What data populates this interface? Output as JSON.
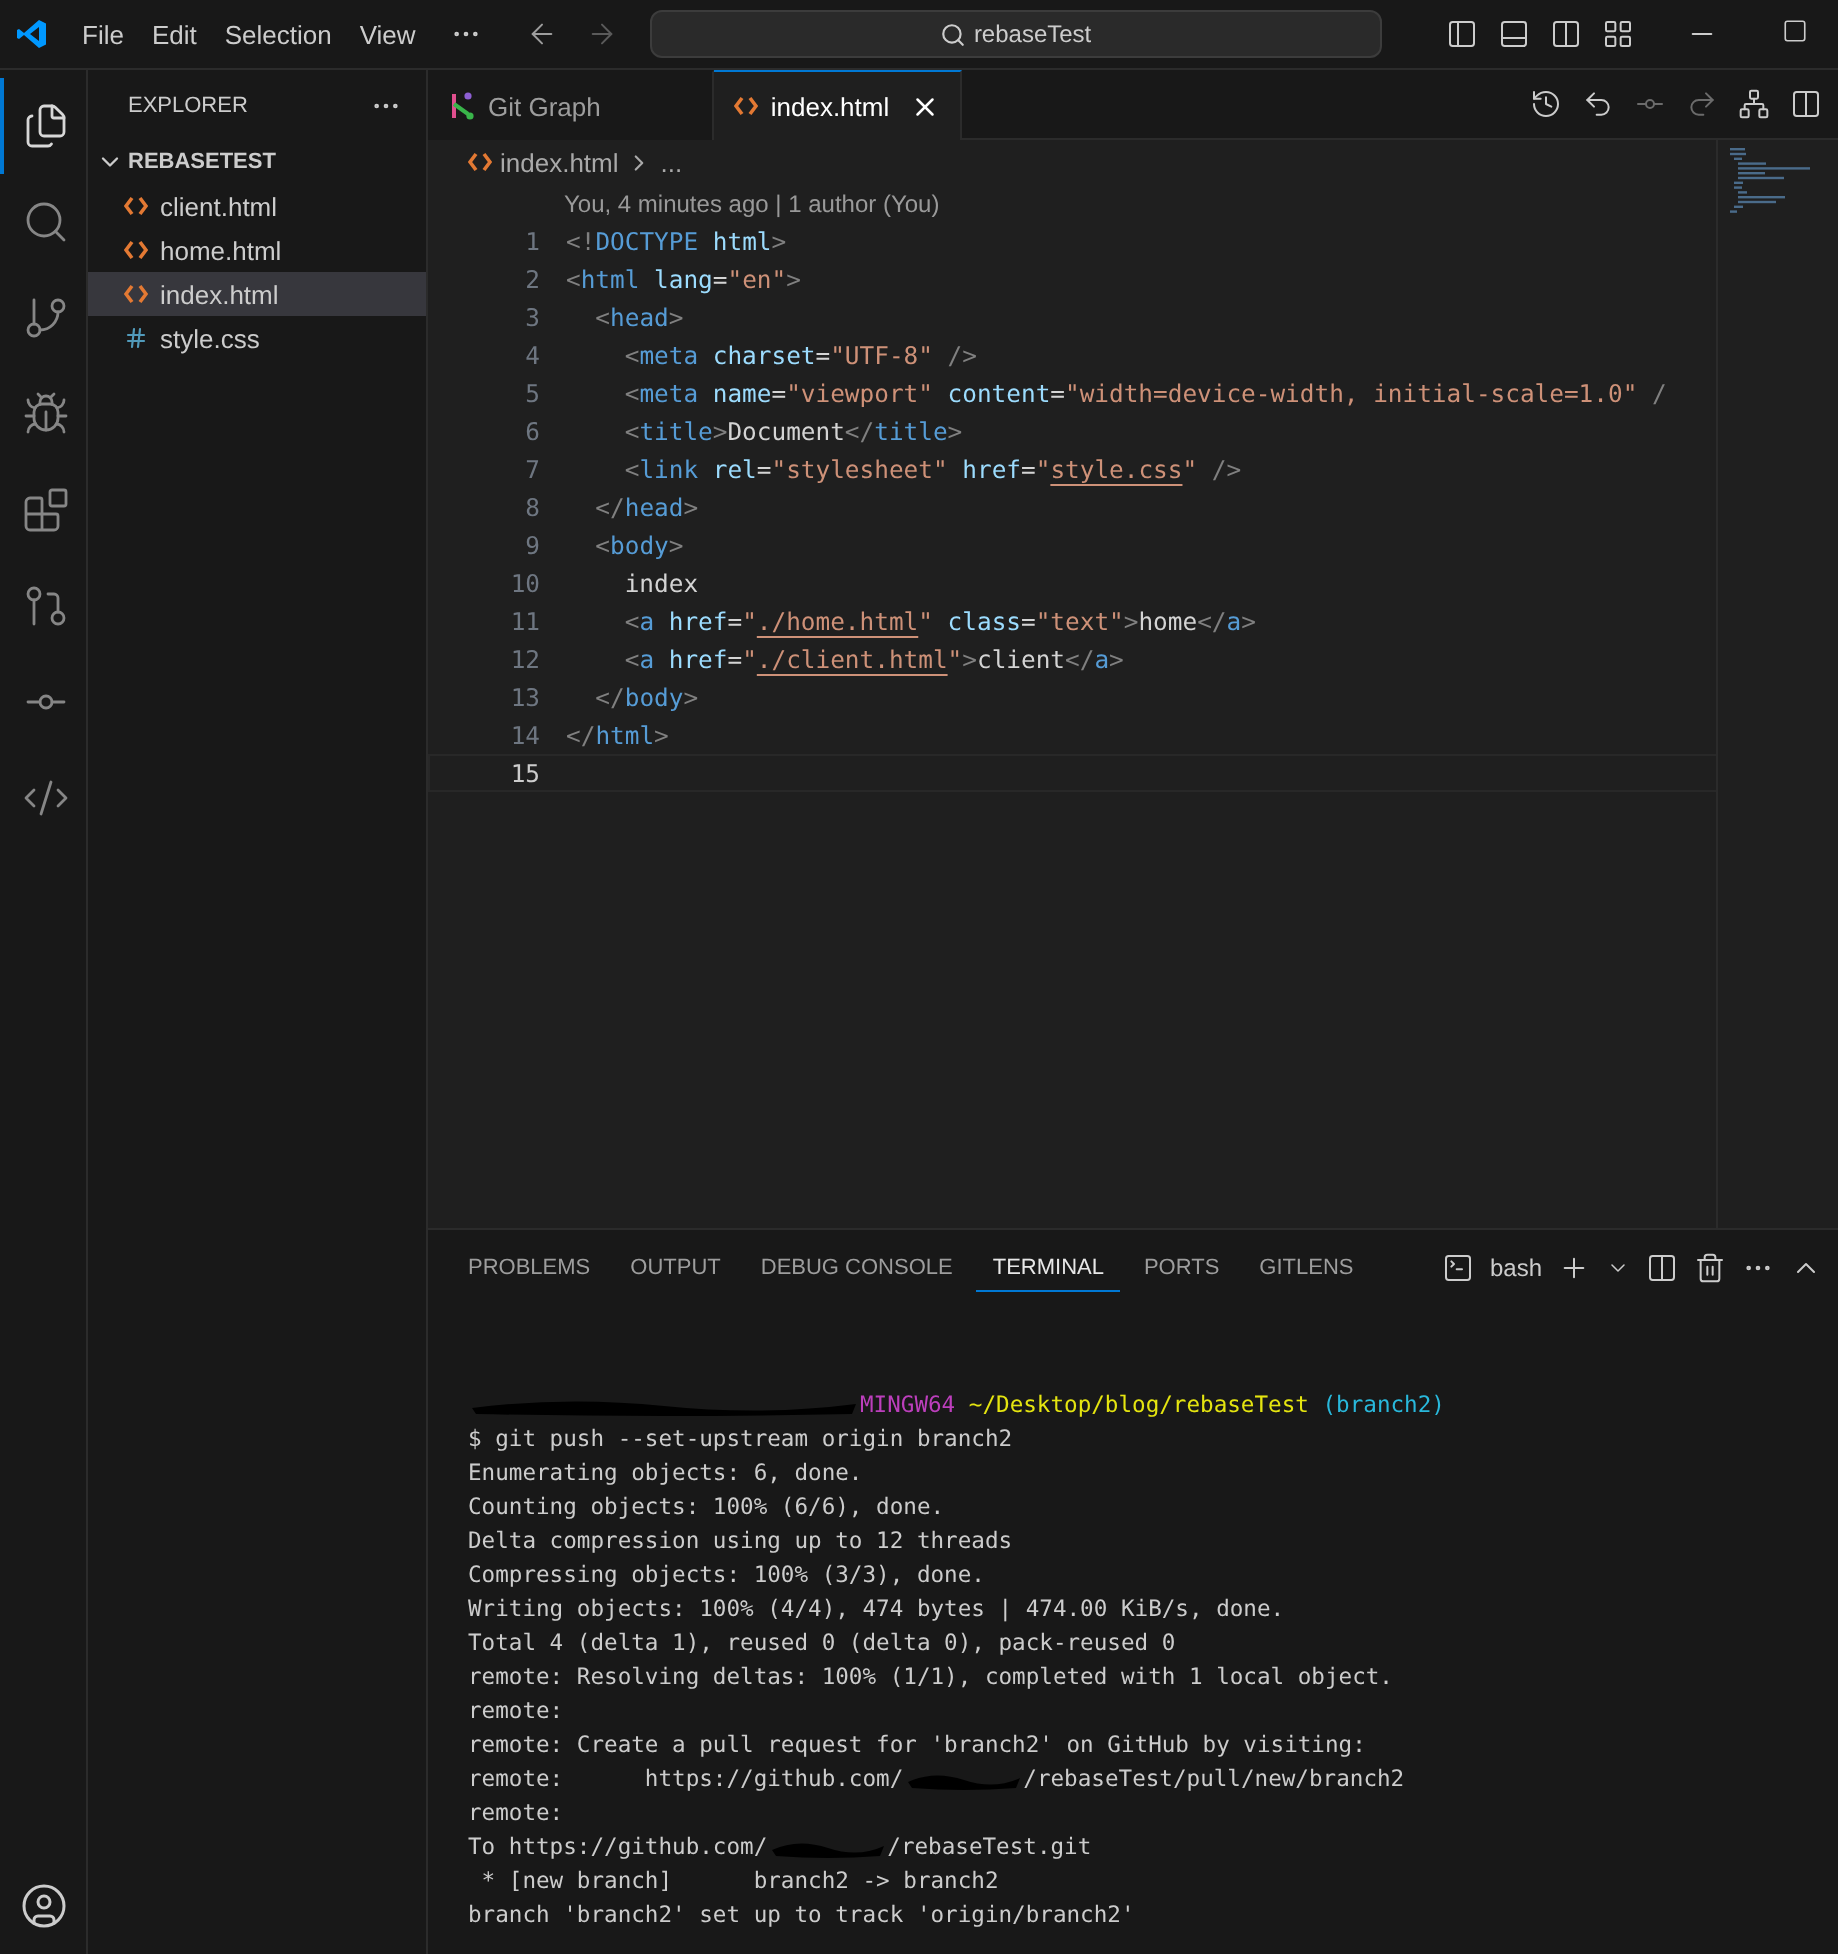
{
  "menu": [
    "File",
    "Edit",
    "Selection",
    "View"
  ],
  "command_center": {
    "text": "rebaseTest"
  },
  "activity_bar": [
    {
      "kind": "explorer",
      "selected": true
    },
    {
      "kind": "search",
      "selected": false
    },
    {
      "kind": "source-control",
      "selected": false
    },
    {
      "kind": "run-debug",
      "selected": false
    },
    {
      "kind": "extensions",
      "selected": false
    },
    {
      "kind": "git-graph",
      "selected": false
    },
    {
      "kind": "git-lens",
      "selected": false
    },
    {
      "kind": "python",
      "selected": false
    }
  ],
  "sidebar": {
    "title": "EXPLORER",
    "folder": {
      "name": "REBASETEST",
      "expanded": true,
      "files": [
        {
          "name": "client.html",
          "kind": "html",
          "selected": false
        },
        {
          "name": "home.html",
          "kind": "html",
          "selected": false
        },
        {
          "name": "index.html",
          "kind": "html",
          "selected": true
        },
        {
          "name": "style.css",
          "kind": "css",
          "selected": false
        }
      ]
    }
  },
  "tabs": [
    {
      "label": "Git Graph",
      "kind": "graph",
      "selected": false
    },
    {
      "label": "index.html",
      "kind": "html",
      "selected": true
    }
  ],
  "breadcrumb": {
    "file": "index.html",
    "rest": "..."
  },
  "blame": "You, 4 minutes ago | 1 author (You)",
  "code_lines": [
    {
      "number": "1",
      "current": false,
      "tokens": [
        {
          "kind": "punct",
          "text": "<!"
        },
        {
          "kind": "tag",
          "text": "DOCTYPE"
        },
        {
          "kind": "attr",
          "text": " html"
        },
        {
          "kind": "punct",
          "text": ">"
        }
      ]
    },
    {
      "number": "2",
      "current": false,
      "tokens": [
        {
          "kind": "punct",
          "text": "<"
        },
        {
          "kind": "tag",
          "text": "html"
        },
        {
          "kind": "attr",
          "text": " lang"
        },
        {
          "kind": "text",
          "text": "="
        },
        {
          "kind": "str",
          "text": "\"en\""
        },
        {
          "kind": "punct",
          "text": ">"
        }
      ]
    },
    {
      "number": "3",
      "current": false,
      "tokens": [
        {
          "kind": "punct",
          "text": "  <"
        },
        {
          "kind": "tag",
          "text": "head"
        },
        {
          "kind": "punct",
          "text": ">"
        }
      ]
    },
    {
      "number": "4",
      "current": false,
      "tokens": [
        {
          "kind": "punct",
          "text": "    <"
        },
        {
          "kind": "tag",
          "text": "meta"
        },
        {
          "kind": "attr",
          "text": " charset"
        },
        {
          "kind": "text",
          "text": "="
        },
        {
          "kind": "str",
          "text": "\"UTF-8\""
        },
        {
          "kind": "punct",
          "text": " />"
        }
      ]
    },
    {
      "number": "5",
      "current": false,
      "tokens": [
        {
          "kind": "punct",
          "text": "    <"
        },
        {
          "kind": "tag",
          "text": "meta"
        },
        {
          "kind": "attr",
          "text": " name"
        },
        {
          "kind": "text",
          "text": "="
        },
        {
          "kind": "str",
          "text": "\"viewport\""
        },
        {
          "kind": "attr",
          "text": " content"
        },
        {
          "kind": "text",
          "text": "="
        },
        {
          "kind": "str",
          "text": "\"width=device-width, initial-scale=1.0\""
        },
        {
          "kind": "punct",
          "text": " /"
        }
      ]
    },
    {
      "number": "6",
      "current": false,
      "tokens": [
        {
          "kind": "punct",
          "text": "    <"
        },
        {
          "kind": "tag",
          "text": "title"
        },
        {
          "kind": "punct",
          "text": ">"
        },
        {
          "kind": "text",
          "text": "Document"
        },
        {
          "kind": "punct",
          "text": "</"
        },
        {
          "kind": "tag",
          "text": "title"
        },
        {
          "kind": "punct",
          "text": ">"
        }
      ]
    },
    {
      "number": "7",
      "current": false,
      "tokens": [
        {
          "kind": "punct",
          "text": "    <"
        },
        {
          "kind": "tag",
          "text": "link"
        },
        {
          "kind": "attr",
          "text": " rel"
        },
        {
          "kind": "text",
          "text": "="
        },
        {
          "kind": "str",
          "text": "\"stylesheet\""
        },
        {
          "kind": "attr",
          "text": " href"
        },
        {
          "kind": "text",
          "text": "="
        },
        {
          "kind": "str",
          "text": "\""
        },
        {
          "kind": "link",
          "text": "style.css"
        },
        {
          "kind": "str",
          "text": "\""
        },
        {
          "kind": "punct",
          "text": " />"
        }
      ]
    },
    {
      "number": "8",
      "current": false,
      "tokens": [
        {
          "kind": "punct",
          "text": "  </"
        },
        {
          "kind": "tag",
          "text": "head"
        },
        {
          "kind": "punct",
          "text": ">"
        }
      ]
    },
    {
      "number": "9",
      "current": false,
      "tokens": [
        {
          "kind": "punct",
          "text": "  <"
        },
        {
          "kind": "tag",
          "text": "body"
        },
        {
          "kind": "punct",
          "text": ">"
        }
      ]
    },
    {
      "number": "10",
      "current": false,
      "tokens": [
        {
          "kind": "text",
          "text": "    index"
        }
      ]
    },
    {
      "number": "11",
      "current": false,
      "tokens": [
        {
          "kind": "punct",
          "text": "    <"
        },
        {
          "kind": "tag",
          "text": "a"
        },
        {
          "kind": "attr",
          "text": " href"
        },
        {
          "kind": "text",
          "text": "="
        },
        {
          "kind": "str",
          "text": "\""
        },
        {
          "kind": "link",
          "text": "./home.html"
        },
        {
          "kind": "str",
          "text": "\""
        },
        {
          "kind": "attr",
          "text": " class"
        },
        {
          "kind": "text",
          "text": "="
        },
        {
          "kind": "str",
          "text": "\"text\""
        },
        {
          "kind": "punct",
          "text": ">"
        },
        {
          "kind": "text",
          "text": "home"
        },
        {
          "kind": "punct",
          "text": "</"
        },
        {
          "kind": "tag",
          "text": "a"
        },
        {
          "kind": "punct",
          "text": ">"
        }
      ]
    },
    {
      "number": "12",
      "current": false,
      "tokens": [
        {
          "kind": "punct",
          "text": "    <"
        },
        {
          "kind": "tag",
          "text": "a"
        },
        {
          "kind": "attr",
          "text": " href"
        },
        {
          "kind": "text",
          "text": "="
        },
        {
          "kind": "str",
          "text": "\""
        },
        {
          "kind": "link",
          "text": "./client.html"
        },
        {
          "kind": "str",
          "text": "\""
        },
        {
          "kind": "punct",
          "text": ">"
        },
        {
          "kind": "text",
          "text": "client"
        },
        {
          "kind": "punct",
          "text": "</"
        },
        {
          "kind": "tag",
          "text": "a"
        },
        {
          "kind": "punct",
          "text": ">"
        }
      ]
    },
    {
      "number": "13",
      "current": false,
      "tokens": [
        {
          "kind": "punct",
          "text": "  </"
        },
        {
          "kind": "tag",
          "text": "body"
        },
        {
          "kind": "punct",
          "text": ">"
        }
      ]
    },
    {
      "number": "14",
      "current": false,
      "tokens": [
        {
          "kind": "punct",
          "text": "</"
        },
        {
          "kind": "tag",
          "text": "html"
        },
        {
          "kind": "punct",
          "text": ">"
        }
      ]
    },
    {
      "number": "15",
      "current": true
    }
  ],
  "panel_tabs": [
    {
      "label": "PROBLEMS",
      "selected": false
    },
    {
      "label": "OUTPUT",
      "selected": false
    },
    {
      "label": "DEBUG CONSOLE",
      "selected": false
    },
    {
      "label": "TERMINAL",
      "selected": true
    },
    {
      "label": "PORTS",
      "selected": false
    },
    {
      "label": "GITLENS",
      "selected": false
    }
  ],
  "terminal_shell": "bash",
  "terminal_lines": [
    {
      "segments": [
        {
          "kind": "redacted"
        },
        {
          "kind": "shell",
          "text": "MINGW64"
        },
        {
          "kind": "path",
          "text": " ~/Desktop/blog/rebaseTest"
        },
        {
          "kind": "branch",
          "text": " (branch2)"
        }
      ]
    },
    {
      "segments": [
        {
          "kind": "plain",
          "text": "$ git push --set-upstream origin branch2"
        }
      ]
    },
    {
      "segments": [
        {
          "kind": "plain",
          "text": "Enumerating objects: 6, done."
        }
      ]
    },
    {
      "segments": [
        {
          "kind": "plain",
          "text": "Counting objects: 100% (6/6), done."
        }
      ]
    },
    {
      "segments": [
        {
          "kind": "plain",
          "text": "Delta compression using up to 12 threads"
        }
      ]
    },
    {
      "segments": [
        {
          "kind": "plain",
          "text": "Compressing objects: 100% (3/3), done."
        }
      ]
    },
    {
      "segments": [
        {
          "kind": "plain",
          "text": "Writing objects: 100% (4/4), 474 bytes | 474.00 KiB/s, done."
        }
      ]
    },
    {
      "segments": [
        {
          "kind": "plain",
          "text": "Total 4 (delta 1), reused 0 (delta 0), pack-reused 0"
        }
      ]
    },
    {
      "segments": [
        {
          "kind": "plain",
          "text": "remote: Resolving deltas: 100% (1/1), completed with 1 local object."
        }
      ]
    },
    {
      "segments": [
        {
          "kind": "plain",
          "text": "remote:"
        }
      ]
    },
    {
      "segments": [
        {
          "kind": "plain",
          "text": "remote: Create a pull request for 'branch2' on GitHub by visiting:"
        }
      ]
    },
    {
      "segments": [
        {
          "kind": "plain",
          "text": "remote:      https://github.com/"
        },
        {
          "kind": "redacted"
        },
        {
          "kind": "plain",
          "text": "/rebaseTest/pull/new/branch2"
        }
      ]
    },
    {
      "segments": [
        {
          "kind": "plain",
          "text": "remote:"
        }
      ]
    },
    {
      "segments": [
        {
          "kind": "plain",
          "text": "To https://github.com/"
        },
        {
          "kind": "redacted"
        },
        {
          "kind": "plain",
          "text": "/rebaseTest.git"
        }
      ]
    },
    {
      "segments": [
        {
          "kind": "plain",
          "text": " * [new branch]      branch2 -> branch2"
        }
      ]
    },
    {
      "segments": [
        {
          "kind": "plain",
          "text": "branch 'branch2' set up to track 'origin/branch2'"
        }
      ]
    }
  ]
}
